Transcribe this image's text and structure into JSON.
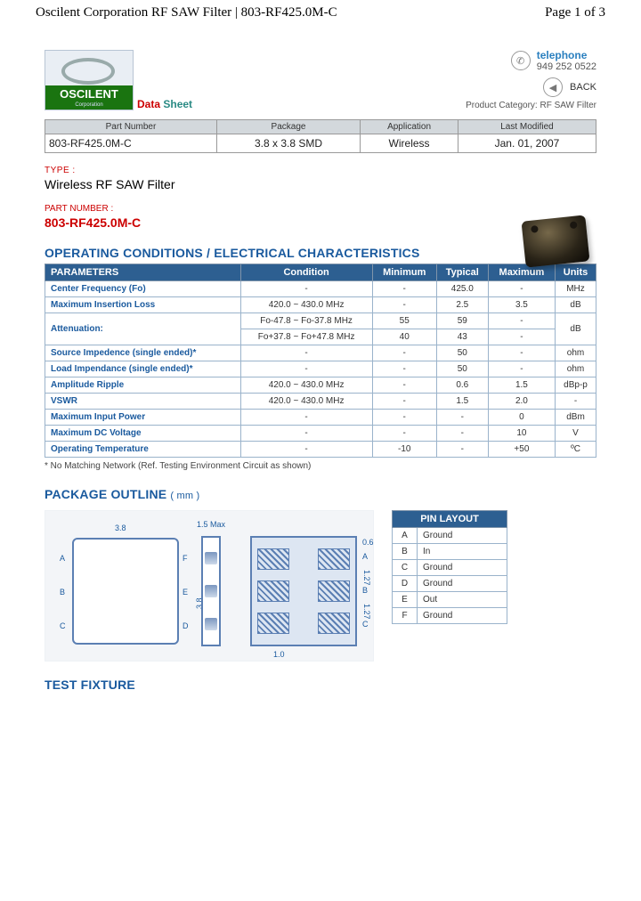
{
  "page_header": {
    "left": "Oscilent Corporation RF SAW Filter | 803-RF425.0M-C",
    "right": "Page 1 of 3"
  },
  "logo": {
    "name": "OSCILENT",
    "sub": "Corporation"
  },
  "datasheet_label": {
    "red": "Data",
    "teal": "Sheet"
  },
  "contact": {
    "phone_label": "telephone",
    "phone_number": "949 252 0522",
    "back_label": "BACK",
    "product_category_label": "Product Category:",
    "product_category_value": "RF SAW Filter"
  },
  "summary": {
    "headers": [
      "Part Number",
      "Package",
      "Application",
      "Last Modified"
    ],
    "values": [
      "803-RF425.0M-C",
      "3.8 x 3.8 SMD",
      "Wireless",
      "Jan. 01, 2007"
    ]
  },
  "type": {
    "label": "TYPE :",
    "value": "Wireless RF SAW Filter"
  },
  "part_number": {
    "label": "PART NUMBER :",
    "value": "803-RF425.0M-C"
  },
  "sections": {
    "operating": "OPERATING CONDITIONS / ELECTRICAL CHARACTERISTICS",
    "package": "PACKAGE OUTLINE",
    "package_unit": "( mm )",
    "test_fixture": "TEST FIXTURE"
  },
  "spec_headers": [
    "PARAMETERS",
    "Condition",
    "Minimum",
    "Typical",
    "Maximum",
    "Units"
  ],
  "spec_rows": [
    {
      "param": "Center Frequency (Fo)",
      "cond": "-",
      "min": "-",
      "typ": "425.0",
      "max": "-",
      "unit": "MHz"
    },
    {
      "param": "Maximum Insertion Loss",
      "cond": "420.0 ~ 430.0 MHz",
      "min": "-",
      "typ": "2.5",
      "max": "3.5",
      "unit": "dB"
    },
    {
      "param": "Attenuation:",
      "cond": "Fo-47.8 ~ Fo-37.8 MHz",
      "min": "55",
      "typ": "59",
      "max": "-",
      "unit": "dB",
      "rowspan_unit": 2
    },
    {
      "param": "",
      "cond": "Fo+37.8 ~ Fo+47.8 MHz",
      "min": "40",
      "typ": "43",
      "max": "-",
      "unit": ""
    },
    {
      "param": "Source Impedence (single ended)*",
      "cond": "-",
      "min": "-",
      "typ": "50",
      "max": "-",
      "unit": "ohm"
    },
    {
      "param": "Load Impendance (single ended)*",
      "cond": "-",
      "min": "-",
      "typ": "50",
      "max": "-",
      "unit": "ohm"
    },
    {
      "param": "Amplitude Ripple",
      "cond": "420.0 ~ 430.0 MHz",
      "min": "-",
      "typ": "0.6",
      "max": "1.5",
      "unit": "dBp-p"
    },
    {
      "param": "VSWR",
      "cond": "420.0 ~ 430.0 MHz",
      "min": "-",
      "typ": "1.5",
      "max": "2.0",
      "unit": "-"
    },
    {
      "param": "Maximum Input Power",
      "cond": "-",
      "min": "-",
      "typ": "-",
      "max": "0",
      "unit": "dBm"
    },
    {
      "param": "Maximum DC Voltage",
      "cond": "-",
      "min": "-",
      "typ": "-",
      "max": "10",
      "unit": "V"
    },
    {
      "param": "Operating Temperature",
      "cond": "-",
      "min": "-10",
      "typ": "-",
      "max": "+50",
      "unit": "ºC"
    }
  ],
  "footnote": "* No Matching Network (Ref. Testing Environment Circuit as shown)",
  "package_dims": {
    "width": "3.8",
    "height": "3.8",
    "thickness": "1.5 Max",
    "pad_h": "0.6",
    "pitch": "1.27",
    "pad_w": "1.0"
  },
  "pin_layout": {
    "header": "PIN LAYOUT",
    "rows": [
      [
        "A",
        "Ground"
      ],
      [
        "B",
        "In"
      ],
      [
        "C",
        "Ground"
      ],
      [
        "D",
        "Ground"
      ],
      [
        "E",
        "Out"
      ],
      [
        "F",
        "Ground"
      ]
    ]
  }
}
